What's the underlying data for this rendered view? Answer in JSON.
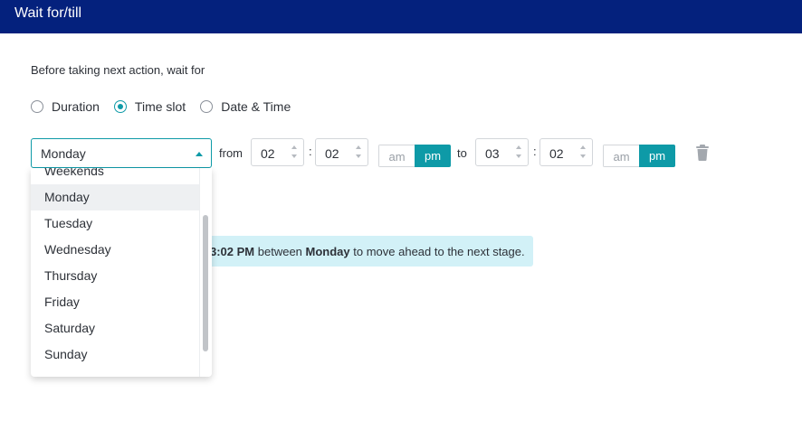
{
  "header": {
    "title": "Wait for/till"
  },
  "intro": "Before taking next action, wait for",
  "radios": [
    {
      "label": "Duration",
      "checked": false
    },
    {
      "label": "Time slot",
      "checked": true
    },
    {
      "label": "Date & Time",
      "checked": false
    }
  ],
  "day_select": {
    "value": "Monday"
  },
  "from_label": "from",
  "to_label": "to",
  "from_time": {
    "hour": "02",
    "minute": "02",
    "am": "am",
    "pm": "pm",
    "selected": "pm"
  },
  "to_time": {
    "hour": "03",
    "minute": "02",
    "am": "am",
    "pm": "pm",
    "selected": "pm"
  },
  "colon": ":",
  "info": {
    "prefix_visible": "3:02 PM",
    "middle": " between ",
    "day": "Monday",
    "suffix": " to move ahead to the next stage."
  },
  "dropdown": {
    "items": [
      "Weekends",
      "Monday",
      "Tuesday",
      "Wednesday",
      "Thursday",
      "Friday",
      "Saturday",
      "Sunday"
    ],
    "selected": "Monday"
  },
  "colors": {
    "header": "#04217d",
    "accent": "#0e9aa7",
    "info_bg": "#d2f1f7"
  }
}
